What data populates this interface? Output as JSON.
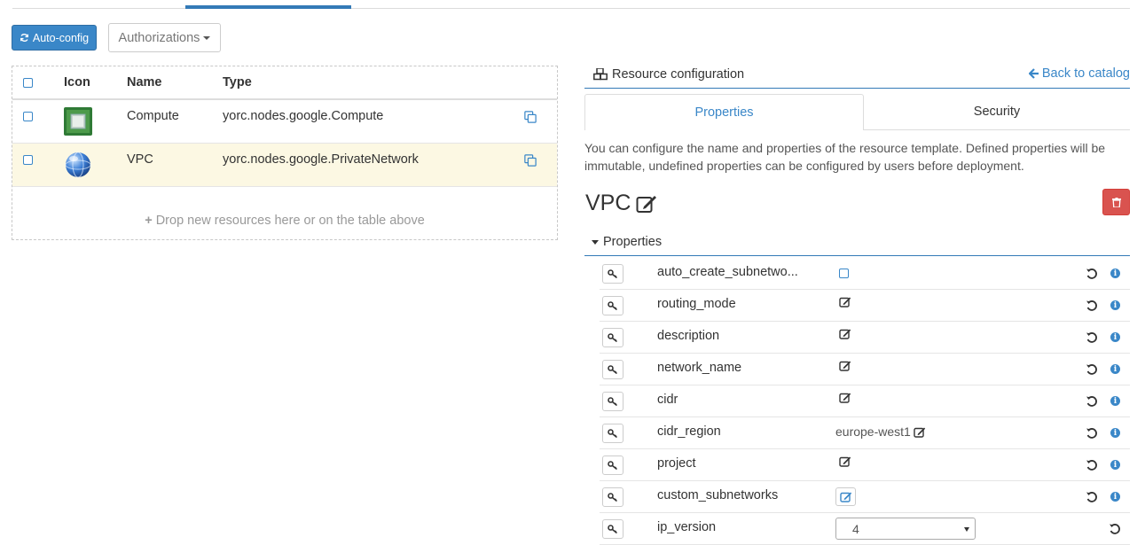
{
  "toolbar": {
    "autoconfig_label": "Auto-config",
    "authorizations_label": "Authorizations"
  },
  "table": {
    "headers": {
      "icon": "Icon",
      "name": "Name",
      "type": "Type"
    },
    "rows": [
      {
        "name": "Compute",
        "type": "yorc.nodes.google.Compute",
        "icon": "compute-chip-icon"
      },
      {
        "name": "VPC",
        "type": "yorc.nodes.google.PrivateNetwork",
        "icon": "network-globe-icon"
      }
    ],
    "drop_text": "Drop new resources here or on the table above"
  },
  "resource_config": {
    "title": "Resource configuration",
    "back_link": "Back to catalog",
    "tabs": {
      "properties": "Properties",
      "security": "Security"
    },
    "description": "You can configure the name and properties of the resource template. Defined properties will be immutable, undefined properties can be configured by users before deployment.",
    "resource_name": "VPC",
    "properties_section": "Properties",
    "properties": [
      {
        "name": "auto_create_subnetwo...",
        "kind": "checkbox"
      },
      {
        "name": "routing_mode",
        "kind": "edit"
      },
      {
        "name": "description",
        "kind": "edit"
      },
      {
        "name": "network_name",
        "kind": "edit"
      },
      {
        "name": "cidr",
        "kind": "edit"
      },
      {
        "name": "cidr_region",
        "kind": "value",
        "value": "europe-west1"
      },
      {
        "name": "project",
        "kind": "edit"
      },
      {
        "name": "custom_subnetworks",
        "kind": "edit-button"
      },
      {
        "name": "ip_version",
        "kind": "select",
        "value": "4"
      }
    ]
  },
  "colors": {
    "primary": "#3a87c8",
    "danger": "#d9534f",
    "highlight_row": "#fcf8e3"
  }
}
